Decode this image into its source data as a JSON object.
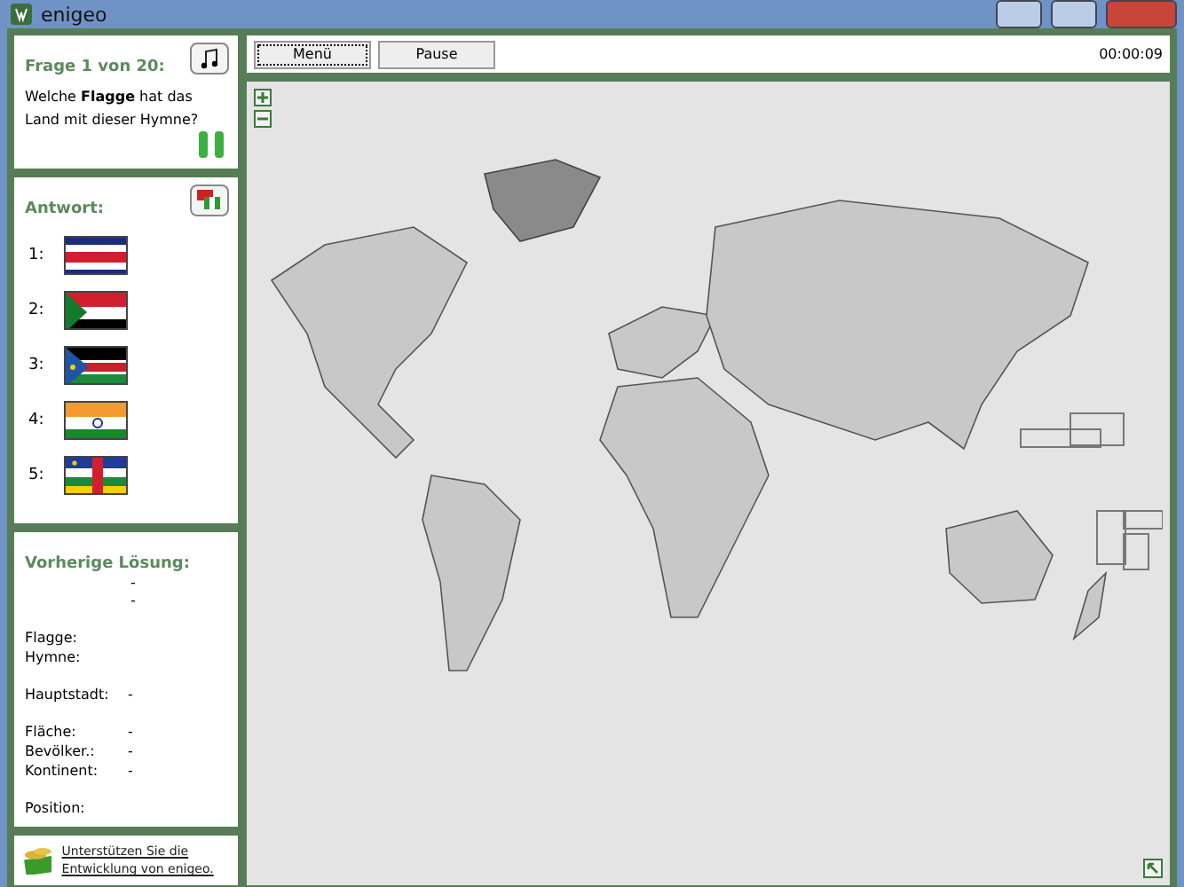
{
  "window": {
    "title": "enigeo"
  },
  "question": {
    "title": "Frage 1 von 20:",
    "text": "Welche **Flagge** hat das Land mit dieser Hymne?"
  },
  "answer": {
    "title": "Antwort:",
    "options": [
      {
        "number": "1:"
      },
      {
        "number": "2:"
      },
      {
        "number": "3:"
      },
      {
        "number": "4:"
      },
      {
        "number": "5:"
      }
    ]
  },
  "previous_solution": {
    "title": "Vorherige Lösung:",
    "lines": [
      "-",
      "-"
    ],
    "groups": [
      [
        {
          "label": "Flagge:"
        },
        {
          "label": "Hymne:"
        }
      ],
      [
        {
          "label": "Hauptstadt:",
          "value": "-"
        }
      ],
      [
        {
          "label": "Fläche:",
          "value": "-"
        },
        {
          "label": "Bevölker.:",
          "value": "-"
        },
        {
          "label": "Kontinent:",
          "value": "-"
        }
      ],
      [
        {
          "label": "Position:"
        }
      ]
    ]
  },
  "support": {
    "text": "Unterstützen Sie die Entwicklung von enigeo."
  },
  "toolbar": {
    "buttons": [
      {
        "label": "Menü",
        "selected": true
      },
      {
        "label": "Pause",
        "selected": false
      }
    ],
    "timer": "00:00:09"
  }
}
